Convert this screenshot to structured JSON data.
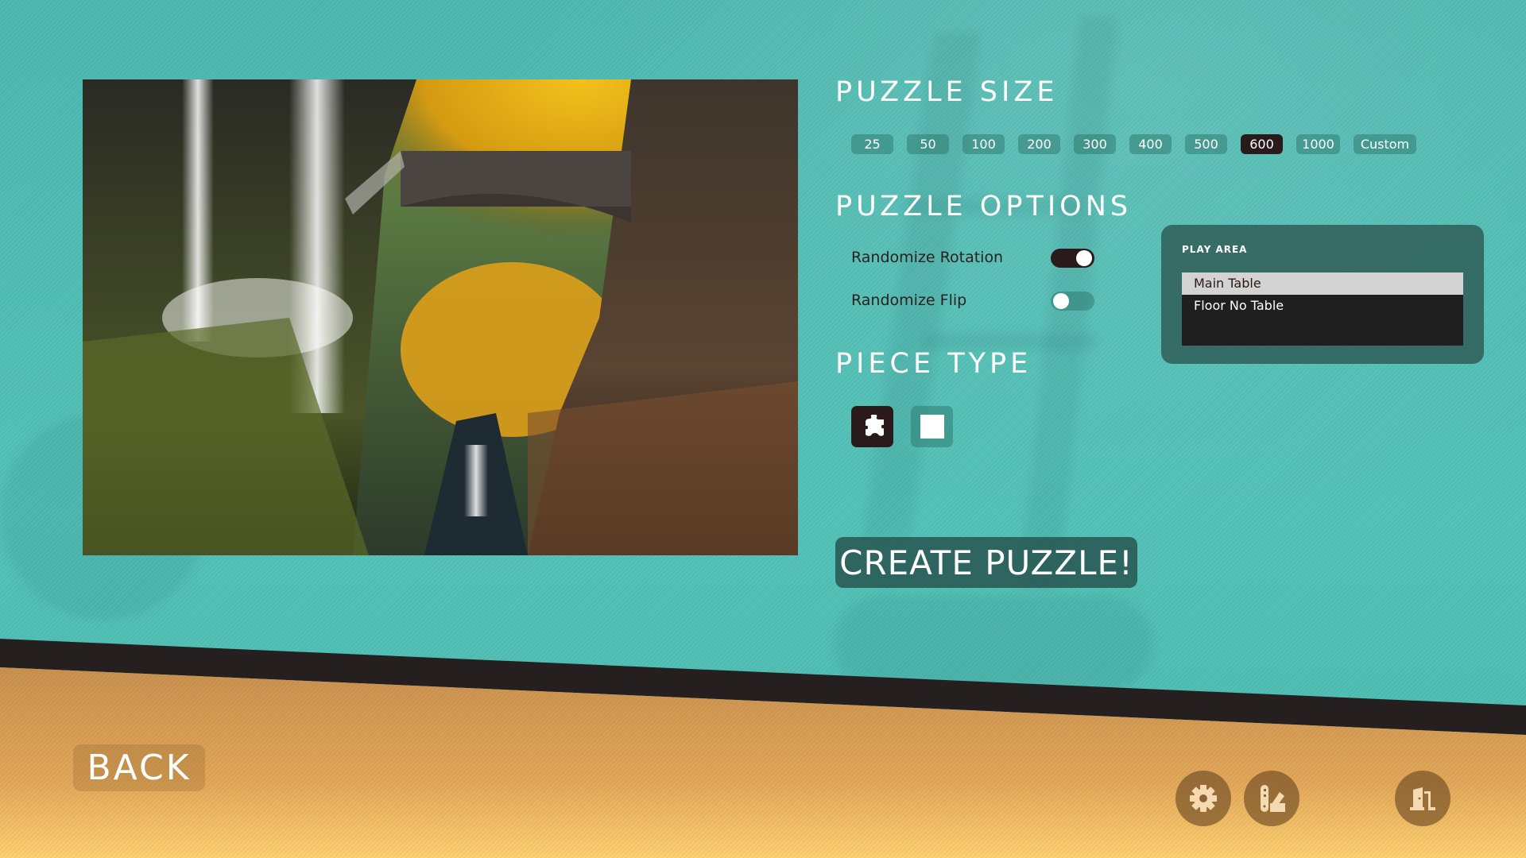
{
  "puzzle_size": {
    "heading": "PUZZLE SIZE",
    "options": [
      "25",
      "50",
      "100",
      "200",
      "300",
      "400",
      "500",
      "600",
      "1000",
      "Custom"
    ],
    "selected": "600"
  },
  "puzzle_options": {
    "heading": "PUZZLE OPTIONS",
    "randomize_rotation": {
      "label": "Randomize Rotation",
      "enabled": true
    },
    "randomize_flip": {
      "label": "Randomize Flip",
      "enabled": false
    }
  },
  "piece_type": {
    "heading": "PIECE TYPE",
    "options": [
      {
        "name": "jigsaw",
        "icon": "jigsaw-piece-icon",
        "selected": true
      },
      {
        "name": "square",
        "icon": "square-piece-icon",
        "selected": false
      }
    ]
  },
  "play_area": {
    "title": "PLAY AREA",
    "options": [
      "Main Table",
      "Floor No Table"
    ],
    "selected": "Main Table"
  },
  "create_button": "CREATE PUZZLE!",
  "back_button": "BACK",
  "footer_icons": [
    "gear-icon",
    "palette-icon",
    "exit-door-icon"
  ],
  "colors": {
    "teal_background": "#52beb4",
    "dark_accent": "#2a1a1c",
    "orange_footer": "#d9a055",
    "icon_fill": "#f5d9b0"
  }
}
